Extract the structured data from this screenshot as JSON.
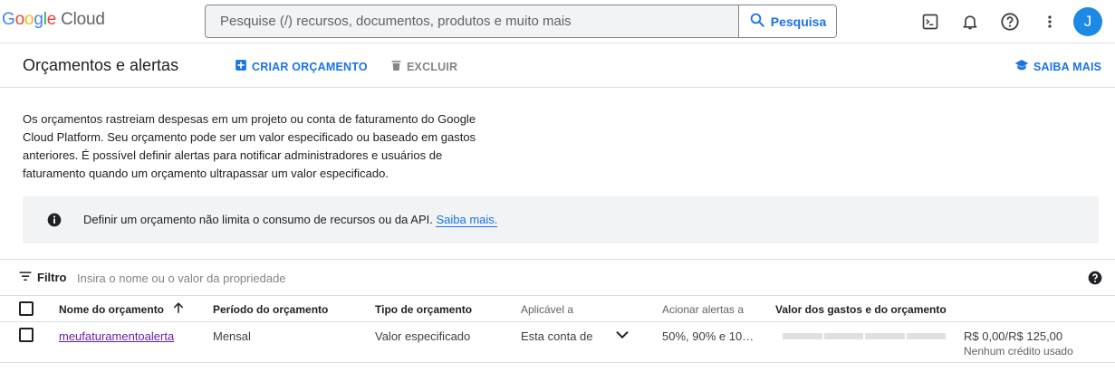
{
  "brand": {
    "google": "Google",
    "cloud": "Cloud"
  },
  "search": {
    "placeholder": "Pesquise (/) recursos, documentos, produtos e muito mais",
    "button_label": "Pesquisa"
  },
  "top_icons": [
    "terminal-icon",
    "bell-icon",
    "help-icon",
    "more-vert-icon"
  ],
  "avatar": {
    "initial": "J",
    "color": "#1e88e5"
  },
  "header": {
    "title": "Orçamentos e alertas",
    "create_label": "CRIAR ORÇAMENTO",
    "delete_label": "EXCLUIR",
    "learn_label": "SAIBA MAIS"
  },
  "description": "Os orçamentos rastreiam despesas em um projeto ou conta de faturamento do Google Cloud Platform. Seu orçamento pode ser um valor especificado ou baseado em gastos anteriores. É possível definir alertas para notificar administradores e usuários de faturamento quando um orçamento ultrapassar um valor especificado.",
  "info": {
    "text": "Definir um orçamento não limita o consumo de recursos ou da API.",
    "link": "Saiba mais."
  },
  "filter": {
    "label": "Filtro",
    "placeholder": "Insira o nome ou o valor da propriedade"
  },
  "table": {
    "columns": {
      "name": "Nome do orçamento",
      "period": "Período do orçamento",
      "type": "Tipo de orçamento",
      "applies": "Aplicável a",
      "alerts": "Acionar alertas a",
      "spend": "Valor dos gastos e do orçamento"
    },
    "rows": [
      {
        "name": "meufaturamentoalerta",
        "period": "Mensal",
        "type": "Valor especificado",
        "applies": "Esta conta de",
        "alerts": "50%, 90% e 10…",
        "spend_progress": 0,
        "amount": "R$ 0,00/R$ 125,00",
        "credits": "Nenhum crédito usado"
      }
    ]
  },
  "colors": {
    "accent": "#1a73e8",
    "link_visited": "#681da8",
    "border": "#dadce0"
  }
}
